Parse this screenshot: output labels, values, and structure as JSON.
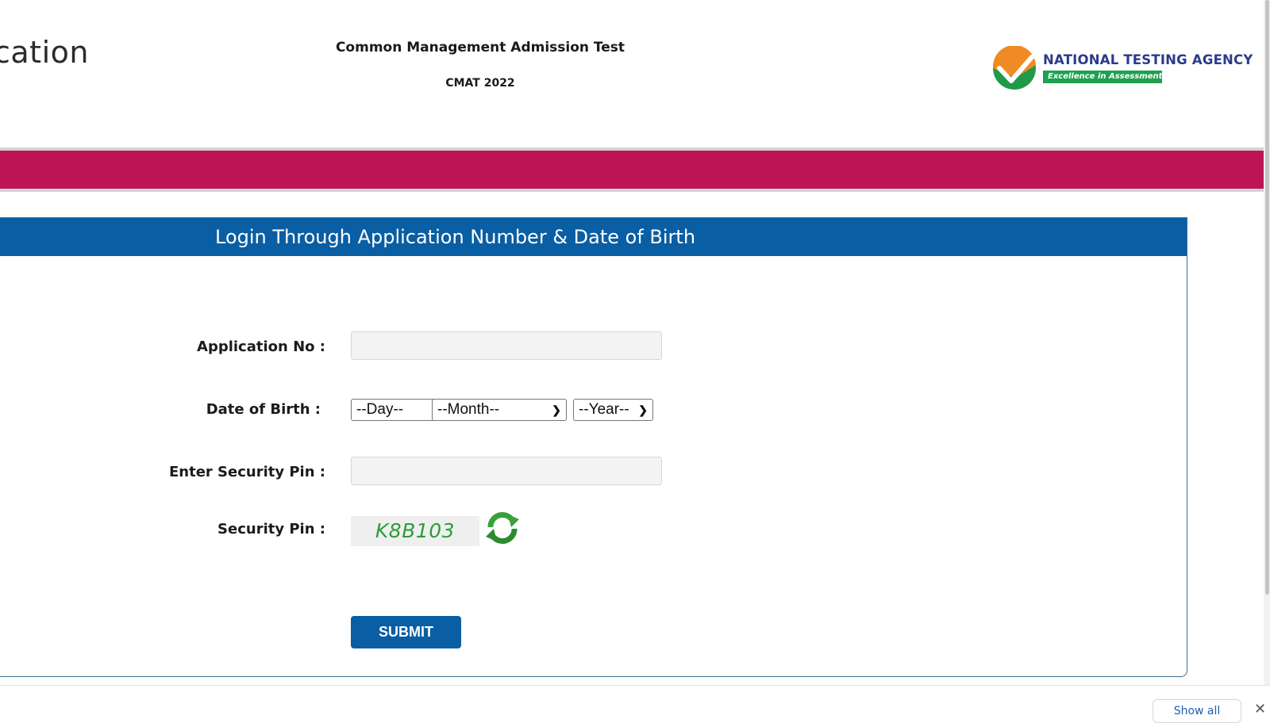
{
  "header": {
    "page_title_fragment": "cation",
    "exam_name": "Common Management Admission Test",
    "exam_code": "CMAT 2022",
    "logo": {
      "name": "NATIONAL TESTING AGENCY",
      "tagline": "Excellence in Assessment",
      "icon": "check-circle-logo-icon"
    }
  },
  "colors": {
    "banner": "#bd1456",
    "panel_header": "#0a5ea3",
    "submit_button": "#0a5ea3",
    "logo_text": "#2b3a8c",
    "logo_tag_bg": "#1fa150",
    "captcha_text": "#2e9d3a"
  },
  "login_panel": {
    "title": "Login Through Application Number & Date of Birth",
    "fields": {
      "application_no": {
        "label": "Application No :",
        "value": "",
        "placeholder": ""
      },
      "date_of_birth": {
        "label": "Date of Birth :",
        "day": "--Day--",
        "month": "--Month--",
        "year": "--Year--"
      },
      "security_pin_input": {
        "label": "Enter Security Pin :",
        "value": "",
        "placeholder": ""
      },
      "security_pin": {
        "label": "Security Pin :",
        "captcha_text": "K8B103",
        "refresh_icon": "refresh-icon"
      }
    },
    "submit_label": "SUBMIT"
  },
  "download_bar": {
    "show_all_label": "Show all",
    "close_icon": "close-icon"
  }
}
